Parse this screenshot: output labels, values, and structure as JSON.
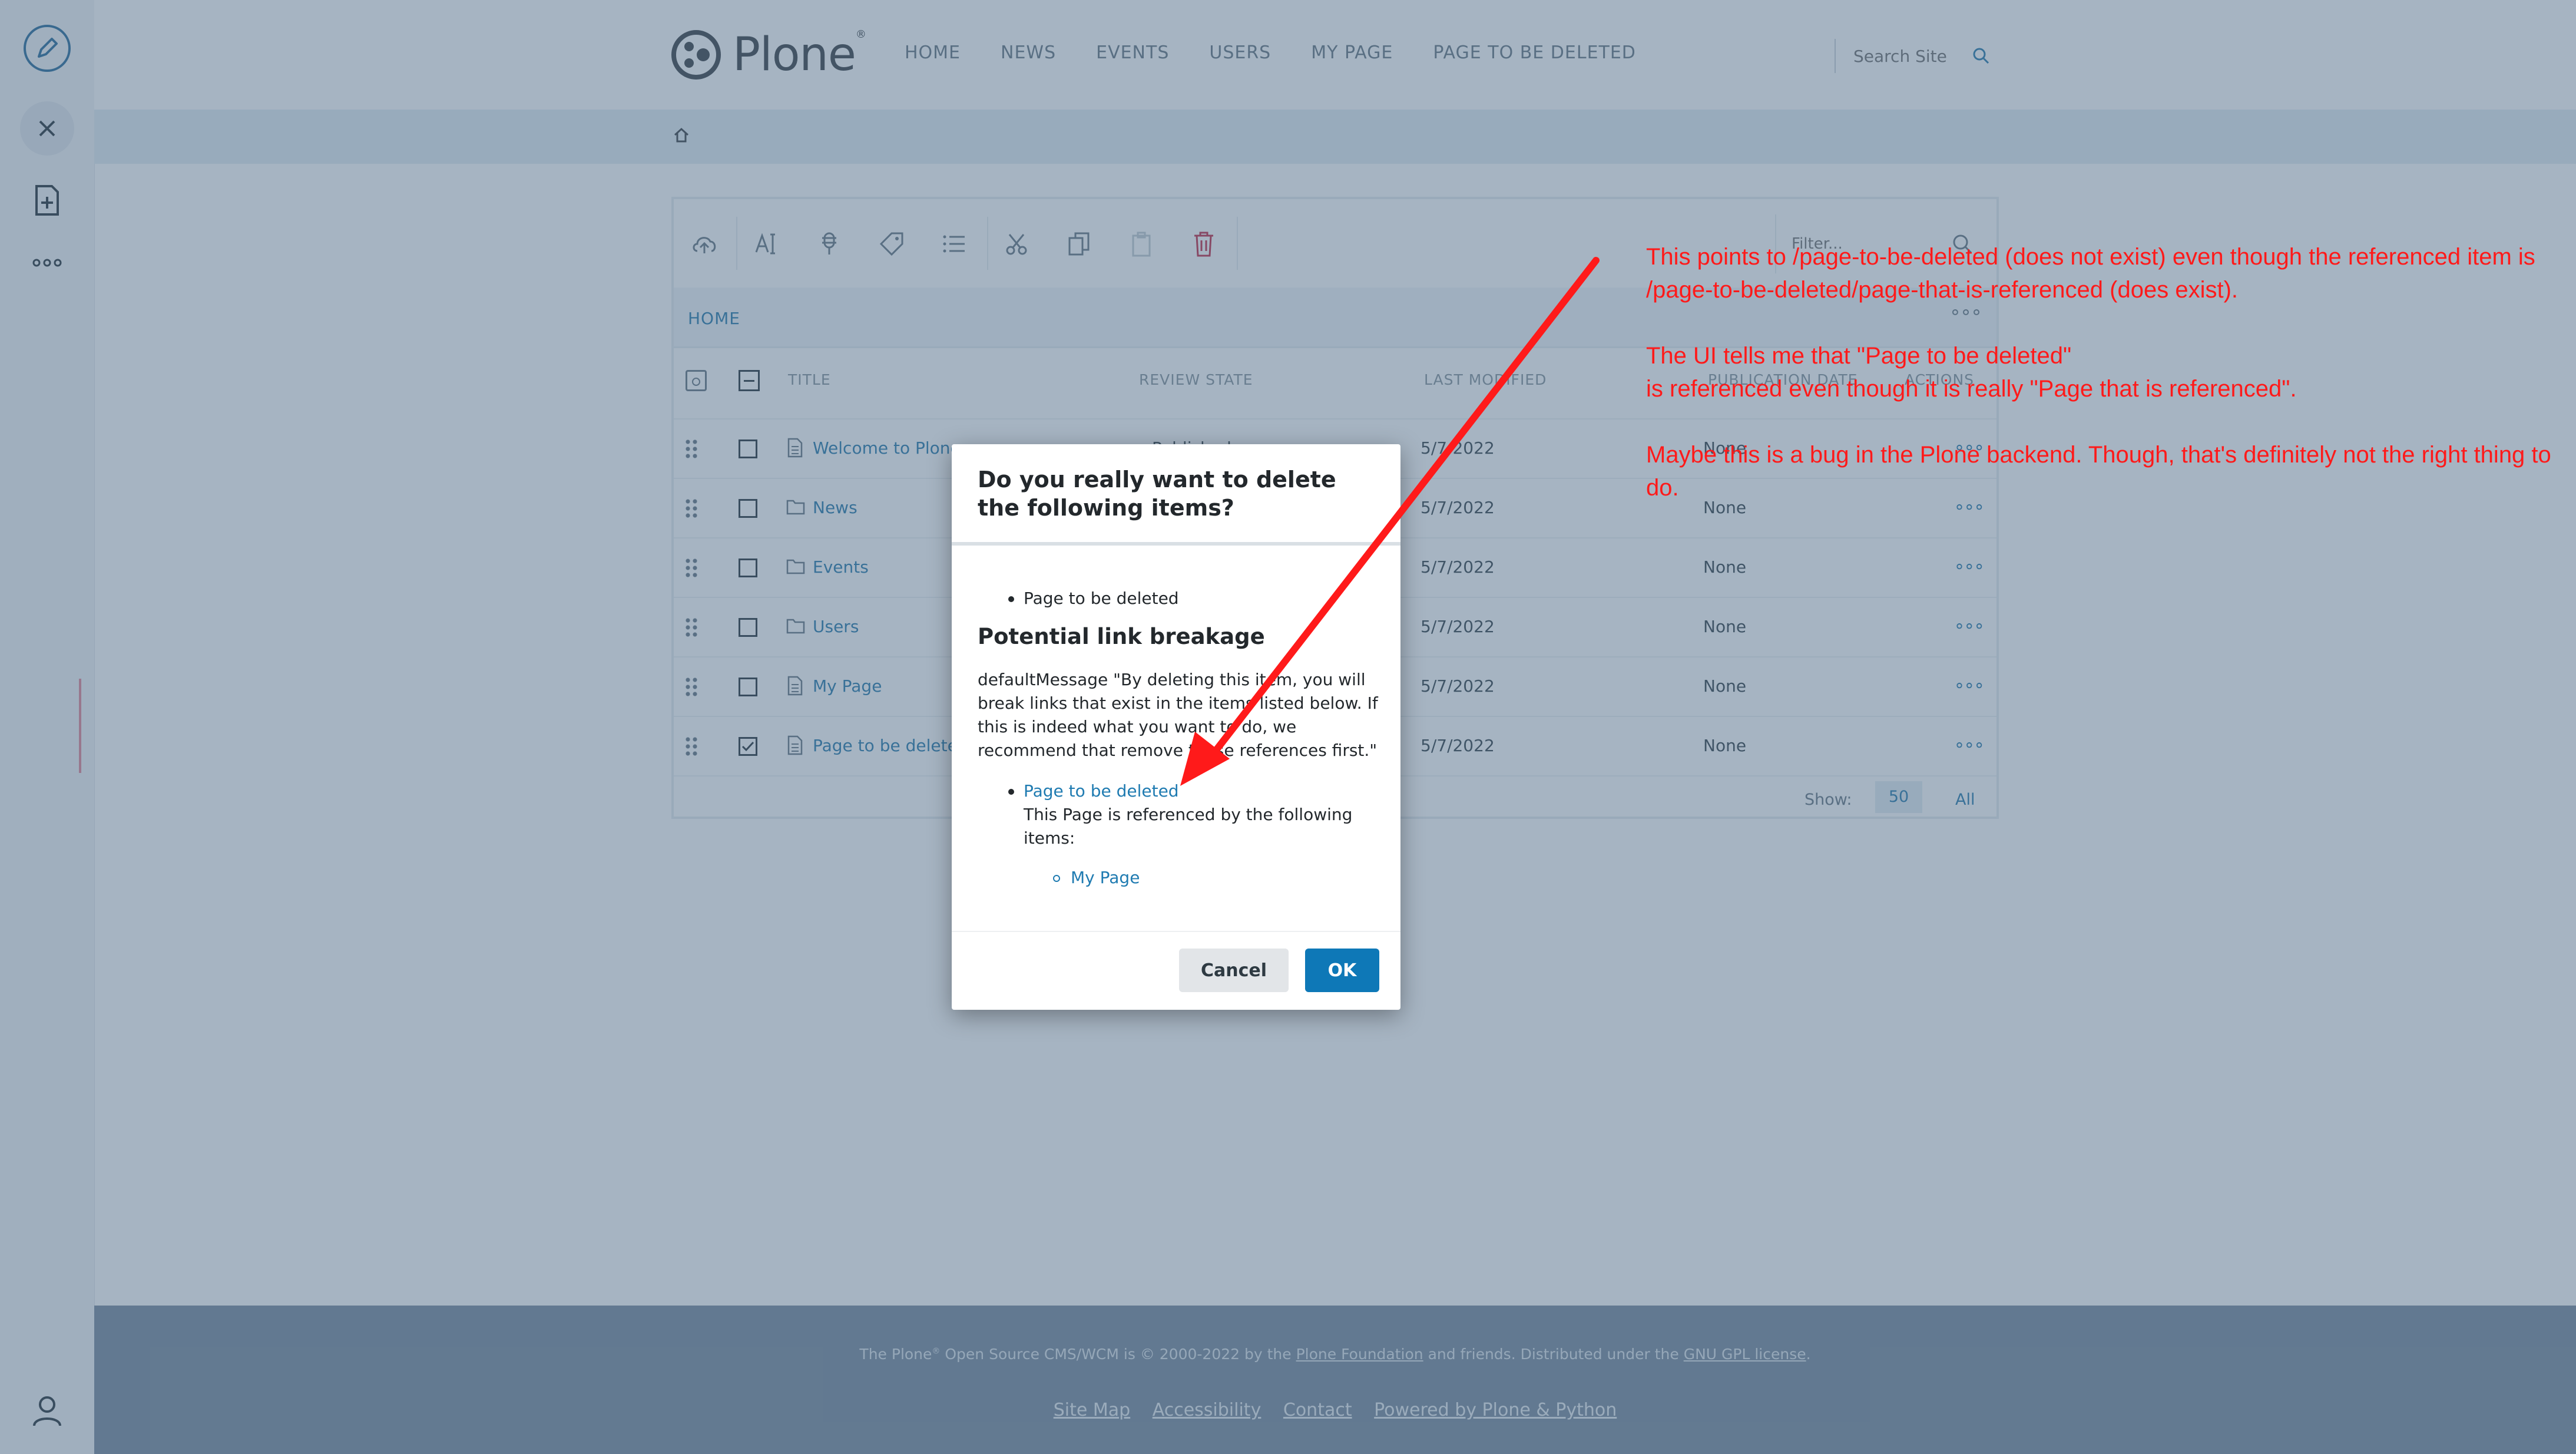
{
  "header": {
    "logo_text": "Plone",
    "logo_mark": "®",
    "nav": [
      "HOME",
      "NEWS",
      "EVENTS",
      "USERS",
      "MY PAGE",
      "PAGE TO BE DELETED"
    ],
    "search_placeholder": "Search Site"
  },
  "contents": {
    "filter_placeholder": "Filter...",
    "path_label": "HOME",
    "columns": [
      "TITLE",
      "REVIEW STATE",
      "LAST MODIFIED",
      "PUBLICATION DATE",
      "ACTIONS"
    ],
    "rows": [
      {
        "title": "Welcome to Plone",
        "state": "Published",
        "modified": "5/7/2022",
        "publication": "None",
        "checked": false,
        "icon": "page-icon"
      },
      {
        "title": "News",
        "state": "",
        "modified": "5/7/2022",
        "publication": "None",
        "checked": false,
        "icon": "folder-icon"
      },
      {
        "title": "Events",
        "state": "",
        "modified": "5/7/2022",
        "publication": "None",
        "checked": false,
        "icon": "folder-icon"
      },
      {
        "title": "Users",
        "state": "",
        "modified": "5/7/2022",
        "publication": "None",
        "checked": false,
        "icon": "folder-icon"
      },
      {
        "title": "My Page",
        "state": "",
        "modified": "5/7/2022",
        "publication": "None",
        "checked": false,
        "icon": "page-icon"
      },
      {
        "title": "Page to be deleted",
        "state": "",
        "modified": "5/7/2022",
        "publication": "None",
        "checked": true,
        "icon": "page-icon"
      }
    ],
    "show_label": "Show:",
    "show_50": "50",
    "show_all": "All"
  },
  "modal": {
    "title": "Do you really want to delete the following items?",
    "item": "Page to be deleted",
    "breakage_heading": "Potential link breakage",
    "message": "defaultMessage \"By deleting this item, you will break links that exist in the items listed below. If this is indeed what you want to do, we recommend that remove these references first.\"",
    "linked_item": "Page to be deleted",
    "referenced_text": "This Page is referenced by the following items:",
    "referrer": "My Page",
    "cancel_label": "Cancel",
    "ok_label": "OK"
  },
  "footer": {
    "text_prefix": "The Plone",
    "text_mark": "®",
    "text_middle": " Open Source CMS/WCM is © 2000-2022 by the ",
    "foundation_link": "Plone Foundation",
    "text_middle2": " and friends. Distributed under the ",
    "license_link": "GNU GPL license",
    "text_end": ".",
    "links": [
      "Site Map",
      "Accessibility",
      "Contact",
      "Powered by Plone & Python"
    ]
  },
  "annotation": {
    "para1": "This points to /page-to-be-deleted (does not exist) even though the referenced item is /page-to-be-deleted/page-that-is-referenced (does exist).",
    "para2_line1": "The UI tells me that \"Page to be deleted\"",
    "para2_line2": "is referenced even though it is really \"Page that is referenced\".",
    "para3": "Maybe this is a bug in the Plone backend. Though, that's definitely not the right thing to do.",
    "color": "#ff1a1a"
  },
  "colors": {
    "accent": "#0e78b7",
    "link": "#1f7bb1",
    "overlay": "#466380",
    "footer_bg": "#7d8fa1",
    "delete_icon": "#c4314b"
  }
}
